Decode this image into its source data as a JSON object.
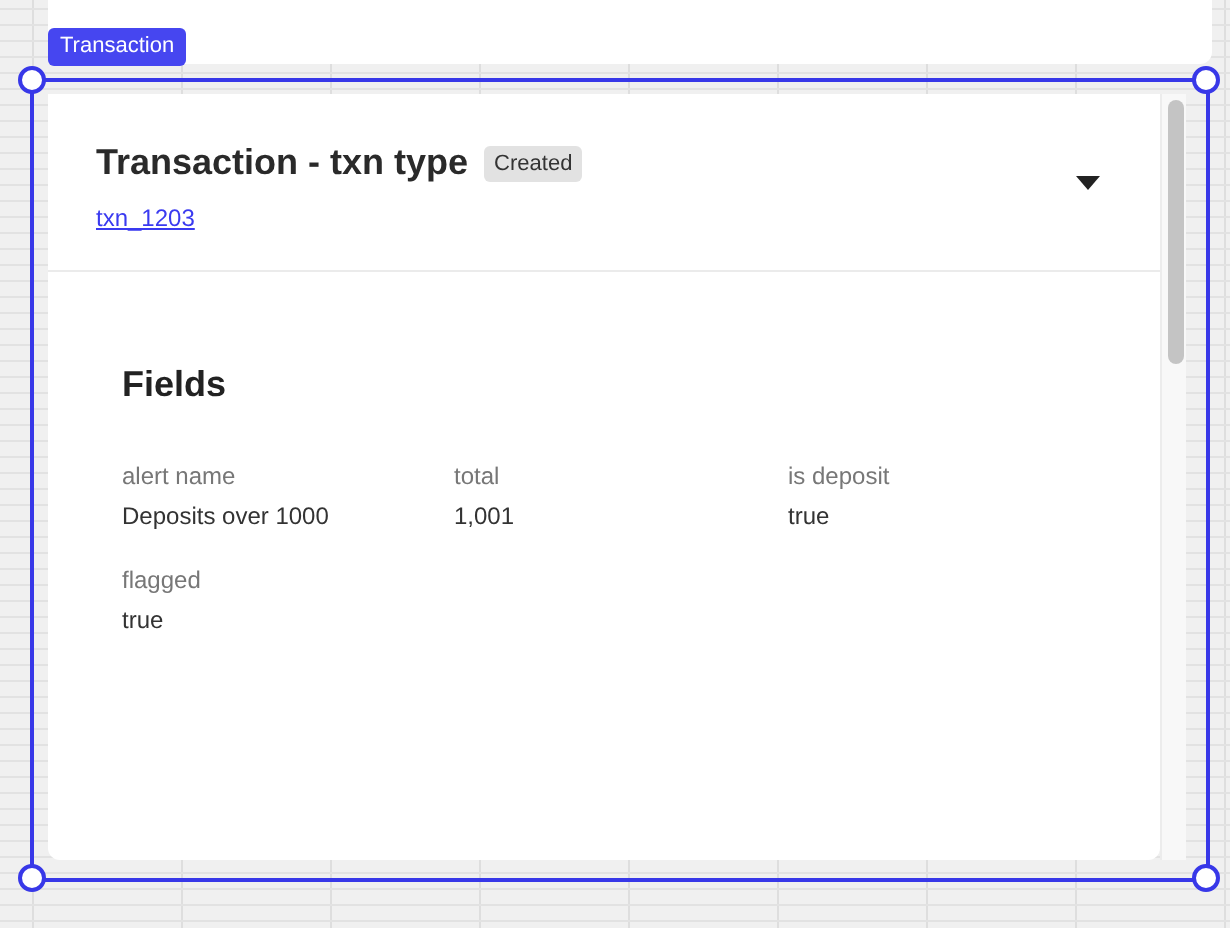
{
  "node_label": "Transaction",
  "card": {
    "title": "Transaction - txn type",
    "status": "Created",
    "link": "txn_1203",
    "expanded": true
  },
  "fields_section": {
    "heading": "Fields",
    "fields": [
      {
        "label": "alert name",
        "value": "Deposits over 1000"
      },
      {
        "label": "total",
        "value": "1,001"
      },
      {
        "label": "is deposit",
        "value": "true"
      },
      {
        "label": "flagged",
        "value": "true"
      }
    ]
  }
}
